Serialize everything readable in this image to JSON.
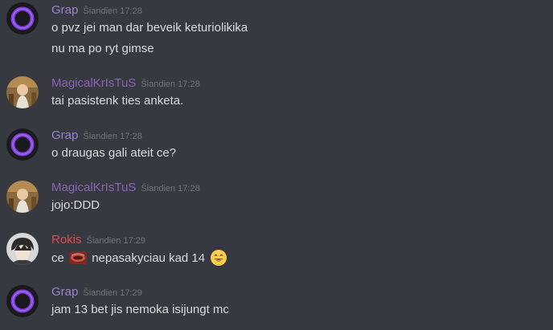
{
  "messages": [
    {
      "username": "Grap",
      "username_color": "#9b84ce",
      "avatar": "purple-ring-avatar",
      "timestamp": "Šiandien 17:28",
      "lines": [
        "o pvz jei man dar beveik keturiolikika",
        "nu ma po ryt gimse"
      ]
    },
    {
      "username": "MagicalKrIsTuS",
      "username_color": "#8b66b8",
      "avatar": "photo-avatar",
      "timestamp": "Šiandien 17:28",
      "lines": [
        "tai pasistenk ties anketa."
      ]
    },
    {
      "username": "Grap",
      "username_color": "#9b84ce",
      "avatar": "purple-ring-avatar",
      "timestamp": "Šiandien 17:28",
      "lines": [
        "o draugas gali ateit ce?"
      ]
    },
    {
      "username": "MagicalKrIsTuS",
      "username_color": "#8b66b8",
      "avatar": "photo-avatar",
      "timestamp": "Šiandien 17:28",
      "lines": [
        "jojo:DDD"
      ]
    },
    {
      "username": "Rokis",
      "username_color": "#e04d4d",
      "avatar": "anime-avatar",
      "timestamp": "Šiandien 17:29",
      "line_parts": {
        "prefix": "ce",
        "custom_emoji": "custom-emoji-image",
        "middle": "nepasakyciau kad 14",
        "emoji": "😄"
      }
    },
    {
      "username": "Grap",
      "username_color": "#9b84ce",
      "avatar": "purple-ring-avatar",
      "timestamp": "Šiandien 17:29",
      "lines": [
        "jam 13 bet jis nemoka isijungt mc"
      ]
    }
  ],
  "colors": {
    "background": "#36393f",
    "message_text": "#dcddde",
    "timestamp": "#72767d"
  }
}
